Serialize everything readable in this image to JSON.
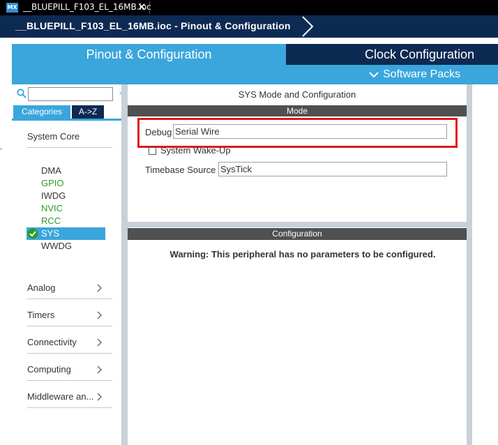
{
  "window": {
    "logo_text": "MX",
    "tab_title": "__BLUEPILL_F103_EL_16MB.ioc",
    "close_glyph": "✕"
  },
  "breadcrumb": {
    "label": "__BLUEPILL_F103_EL_16MB.ioc - Pinout & Configuration"
  },
  "main_tabs": {
    "pinout": "Pinout & Configuration",
    "clock": "Clock Configuration",
    "software_packs": "Software Packs"
  },
  "left_panel": {
    "search": {
      "value": "",
      "placeholder": ""
    },
    "collapse_glyph": "»",
    "tabs": {
      "categories": "Categories",
      "az": "A->Z"
    },
    "groups": {
      "system_core": "System Core",
      "analog": "Analog",
      "timers": "Timers",
      "connectivity": "Connectivity",
      "computing": "Computing",
      "middleware": "Middleware an..."
    },
    "peripherals": [
      "DMA",
      "GPIO",
      "IWDG",
      "NVIC",
      "RCC",
      "SYS",
      "WWDG"
    ],
    "selected": "SYS"
  },
  "mode_panel": {
    "title": "SYS Mode and Configuration",
    "header": "Mode",
    "debug_label": "Debug",
    "debug_value": "Serial Wire",
    "wakeup_label": "System Wake-Up",
    "timebase_label": "Timebase Source",
    "timebase_value": "SysTick"
  },
  "config_panel": {
    "header": "Configuration",
    "warning": "Warning: This peripheral has no parameters to be configured."
  },
  "colors": {
    "accent_blue": "#3aa6dc",
    "navy": "#0d2a52",
    "highlight_red": "#e01919",
    "enabled_green": "#2a9a2a"
  }
}
